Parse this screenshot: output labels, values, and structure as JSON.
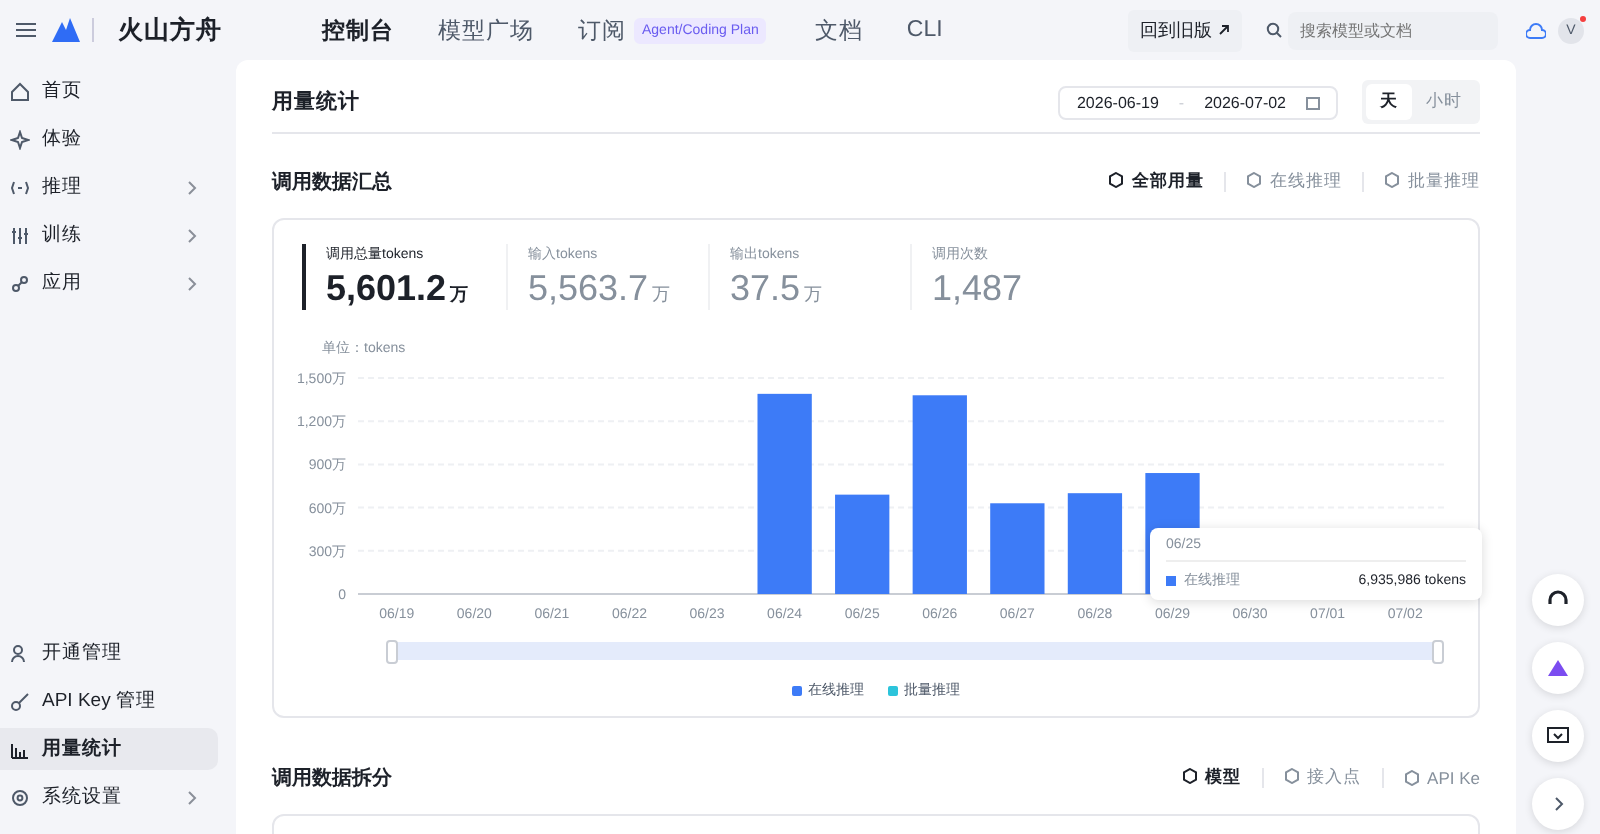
{
  "topbar": {
    "brand": "火山方舟",
    "nav": [
      {
        "label": "控制台",
        "selected": true
      },
      {
        "label": "模型广场",
        "selected": false
      },
      {
        "label": "订阅",
        "selected": false,
        "badge": "Agent/Coding Plan"
      },
      {
        "label": "文档",
        "selected": false
      },
      {
        "label": "CLI",
        "selected": false
      }
    ],
    "old_version_button": "回到旧版",
    "search": {
      "placeholder": "搜索模型或文档"
    },
    "avatar": "V",
    "notification": true
  },
  "sidebar": {
    "items": [
      {
        "label": "首页",
        "expandable": false,
        "selected": false
      },
      {
        "label": "体验",
        "expandable": false,
        "selected": false
      },
      {
        "label": "推理",
        "expandable": true,
        "selected": false
      },
      {
        "label": "训练",
        "expandable": true,
        "selected": false
      },
      {
        "label": "应用",
        "expandable": true,
        "selected": false
      }
    ],
    "footer_items": [
      {
        "label": "开通管理",
        "expandable": false,
        "selected": false
      },
      {
        "label": "API Key 管理",
        "expandable": false,
        "selected": false
      },
      {
        "label": "用量统计",
        "expandable": false,
        "selected": true
      },
      {
        "label": "系统设置",
        "expandable": true,
        "selected": false
      }
    ]
  },
  "page": {
    "title": "用量统计",
    "date_range": {
      "start": "2026-06-19",
      "separator": "-",
      "end": "2026-07-02"
    },
    "granularity": [
      {
        "label": "天",
        "selected": true
      },
      {
        "label": "小时",
        "selected": false
      }
    ]
  },
  "summary": {
    "title": "调用数据汇总",
    "filters": [
      {
        "label": "全部用量",
        "selected": true
      },
      {
        "label": "在线推理",
        "selected": false
      },
      {
        "label": "批量推理",
        "selected": false
      }
    ],
    "stats": [
      {
        "label": "调用总量tokens",
        "value": "5,601.2",
        "unit": "万",
        "selected": true
      },
      {
        "label": "输入tokens",
        "value": "5,563.7",
        "unit": "万",
        "selected": false
      },
      {
        "label": "输出tokens",
        "value": "37.5",
        "unit": "万",
        "selected": false
      },
      {
        "label": "调用次数",
        "value": "1,487",
        "selected": false
      }
    ],
    "unit_label": "单位：tokens",
    "chart_data": {
      "type": "bar",
      "categories": [
        "06/19",
        "06/20",
        "06/21",
        "06/22",
        "06/23",
        "06/24",
        "06/25",
        "06/26",
        "06/27",
        "06/28",
        "06/29",
        "06/30",
        "07/01",
        "07/02"
      ],
      "series": [
        {
          "name": "在线推理",
          "color": "#3d7bf7",
          "values": [
            0,
            0,
            0,
            0,
            0,
            1390,
            690,
            1380,
            630,
            700,
            840,
            0,
            0,
            0
          ]
        },
        {
          "name": "批量推理",
          "color": "#2cc4db",
          "values": [
            0,
            0,
            0,
            0,
            0,
            0,
            0,
            0,
            0,
            0,
            0,
            0,
            0,
            0
          ]
        }
      ],
      "grid": true,
      "ylim": [
        0,
        1500
      ],
      "yticks": [
        {
          "value": 0,
          "label": "0"
        },
        {
          "value": 300,
          "label": "300万"
        },
        {
          "value": 600,
          "label": "600万"
        },
        {
          "value": 900,
          "label": "900万"
        },
        {
          "value": 1200,
          "label": "1,200万"
        },
        {
          "value": 1500,
          "label": "1,500万"
        }
      ]
    },
    "range_slider": {
      "level": 1
    },
    "tooltip": {
      "title": "06/25",
      "series": "在线推理",
      "value": "6,935,986 tokens"
    }
  },
  "breakdown": {
    "title": "调用数据拆分",
    "filters": [
      {
        "label": "模型",
        "selected": true
      },
      {
        "label": "接入点",
        "selected": false
      },
      {
        "label": "API Ke",
        "selected": false
      }
    ]
  }
}
